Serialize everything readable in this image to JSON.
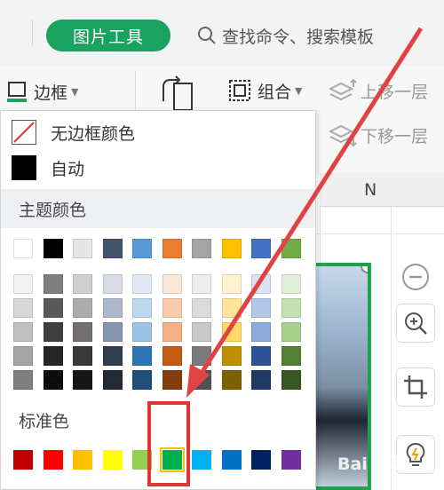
{
  "toolbar": {
    "pic_tools_label": "图片工具",
    "search_placeholder": "查找命令、搜索模板"
  },
  "ribbon": {
    "border_label": "边框",
    "group_label": "组合",
    "bring_forward_label": "上移一层",
    "send_backward_label": "下移一层"
  },
  "sheet": {
    "column_label": "N"
  },
  "dropdown": {
    "no_border_label": "无边框颜色",
    "auto_label": "自动",
    "theme_title": "主题颜色",
    "standard_title": "标准色",
    "theme_top_row": [
      "#ffffff",
      "#000000",
      "#e7e6e6",
      "#44546a",
      "#5b9bd5",
      "#ed7d31",
      "#a5a5a5",
      "#ffc000",
      "#4472c4",
      "#70ad47"
    ],
    "theme_shades": [
      [
        "#f2f2f2",
        "#7f7f7f",
        "#d0cece",
        "#d6dce4",
        "#deebf6",
        "#fbe5d5",
        "#ededed",
        "#fff2cc",
        "#d9e2f3",
        "#e2efd9"
      ],
      [
        "#d8d8d8",
        "#595959",
        "#aeabab",
        "#adb9ca",
        "#bdd7ee",
        "#f7cbac",
        "#dbdbdb",
        "#fee599",
        "#b4c6e7",
        "#c5e0b3"
      ],
      [
        "#bfbfbf",
        "#3f3f3f",
        "#757070",
        "#8496b0",
        "#9cc3e5",
        "#f4b183",
        "#c9c9c9",
        "#ffd965",
        "#8eaadb",
        "#a8d08d"
      ],
      [
        "#a5a5a5",
        "#262626",
        "#3a3838",
        "#323f4f",
        "#2e75b5",
        "#c55a11",
        "#7b7b7b",
        "#bf9000",
        "#2f5496",
        "#538135"
      ],
      [
        "#7f7f7f",
        "#0c0c0c",
        "#171616",
        "#222a35",
        "#1e4e79",
        "#833c0b",
        "#525252",
        "#7f6000",
        "#1f3864",
        "#375623"
      ]
    ],
    "standard_colors": [
      "#c00000",
      "#ff0000",
      "#ffc000",
      "#ffff00",
      "#92d050",
      "#00b050",
      "#00b0f0",
      "#0070c0",
      "#002060",
      "#7030a0"
    ],
    "selected_standard_index": 5
  },
  "watermark": "Bai 经验"
}
